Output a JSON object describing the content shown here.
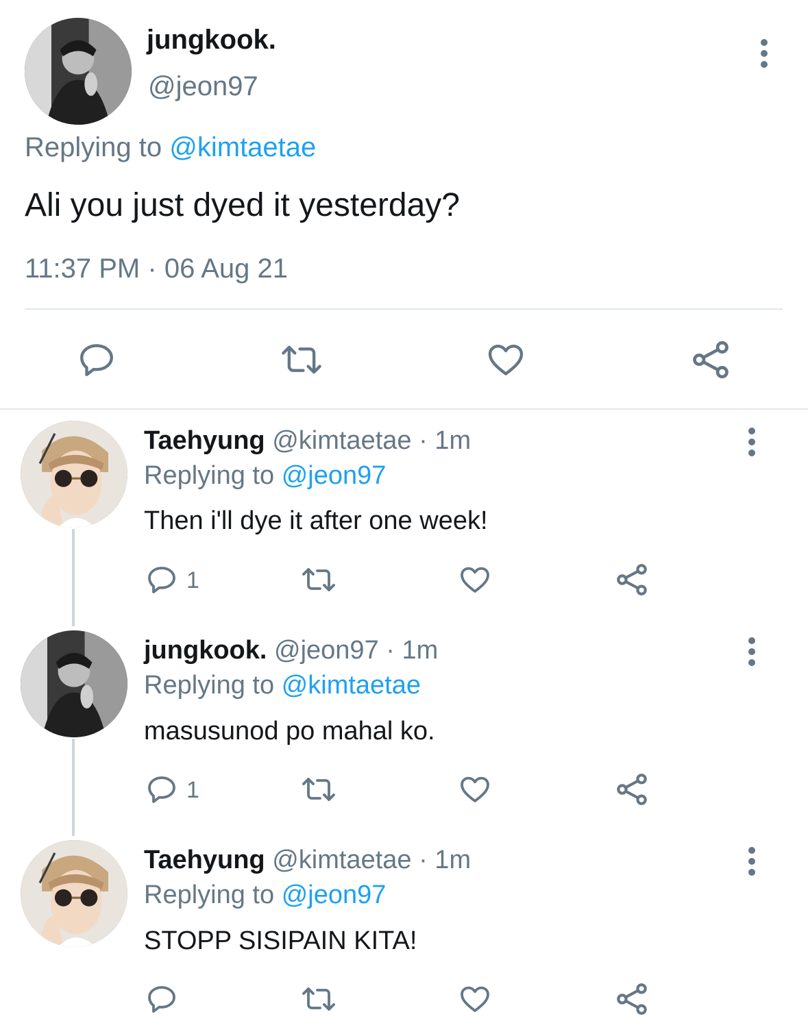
{
  "main_tweet": {
    "display_name": "jungkook.",
    "handle": "@jeon97",
    "replying_prefix": "Replying to",
    "replying_to": "@kimtaetae",
    "text": "Ali you just dyed it yesterday?",
    "time": "11:37 PM",
    "separator": "·",
    "date": "06 Aug 21",
    "actions": [
      "reply-icon",
      "retweet-icon",
      "like-icon",
      "share-icon"
    ]
  },
  "replies": [
    {
      "display_name": "Taehyung",
      "handle": "@kimtaetae",
      "time_ago": "· 1m",
      "replying_prefix": "Replying to",
      "replying_to": "@jeon97",
      "text": "Then i'll dye it after one week!",
      "reply_count": "1"
    },
    {
      "display_name": "jungkook.",
      "handle": "@jeon97",
      "time_ago": "· 1m",
      "replying_prefix": "Replying to",
      "replying_to": "@kimtaetae",
      "text": "masusunod po mahal ko.",
      "reply_count": "1"
    },
    {
      "display_name": "Taehyung",
      "handle": "@kimtaetae",
      "time_ago": "· 1m",
      "replying_prefix": "Replying to",
      "replying_to": "@jeon97",
      "text": "STOPP SISIPAIN KITA!",
      "reply_count": ""
    }
  ],
  "colors": {
    "text": "#14171a",
    "secondary": "#657786",
    "link": "#1da1f2",
    "divider": "#e1e8ed"
  }
}
